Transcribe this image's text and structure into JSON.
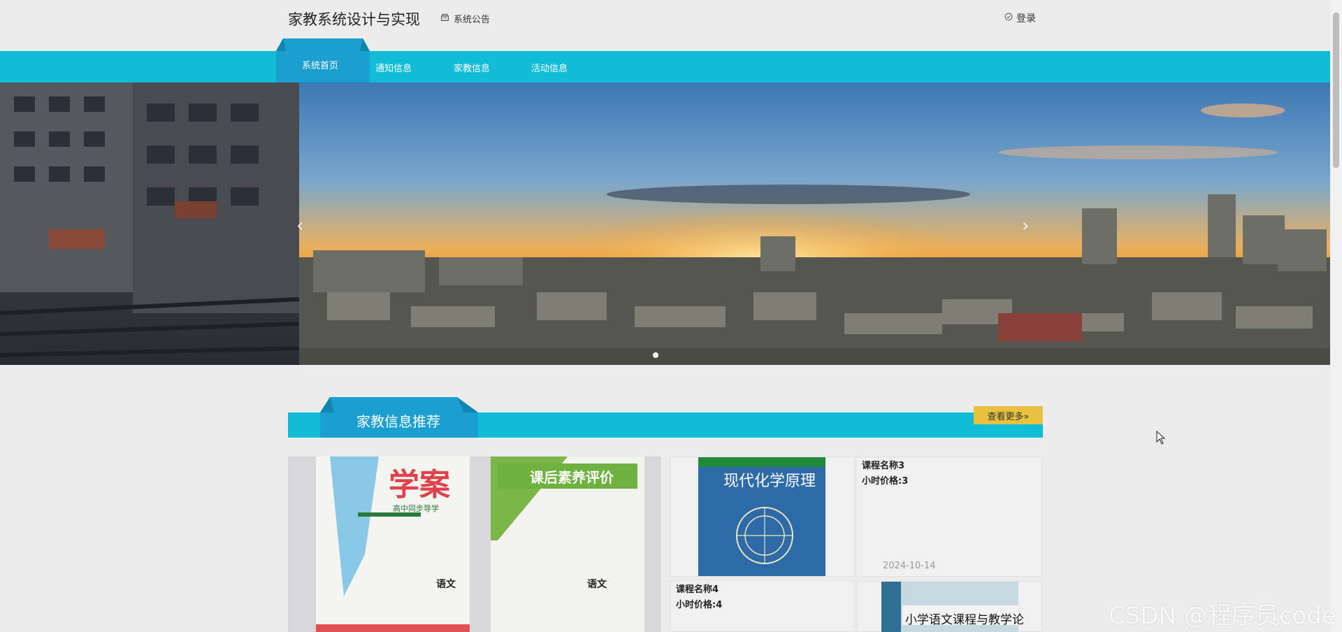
{
  "header": {
    "site_title": "家教系统设计与实现",
    "notice_label": "系统公告",
    "login_label": "登录"
  },
  "nav": {
    "items": [
      {
        "label": "系统首页",
        "active": true
      },
      {
        "label": "通知信息",
        "active": false
      },
      {
        "label": "家教信息",
        "active": false
      },
      {
        "label": "活动信息",
        "active": false
      }
    ]
  },
  "banner": {
    "prev_icon": "chevron-left-icon",
    "next_icon": "chevron-right-icon",
    "dot_count": 1
  },
  "section": {
    "title": "家教信息推荐",
    "more_label": "查看更多»"
  },
  "cards": {
    "big_book_left_title": "学案",
    "big_book_left_sub": "高中同步导学",
    "big_book_left_subject": "语文",
    "big_book_right_title": "课后素养评价",
    "big_book_right_subject": "语文",
    "card3": {
      "book_title": "现代化学原理",
      "name": "课程名称3",
      "price": "小时价格:3",
      "date": "2024-10-14"
    },
    "card4": {
      "name": "课程名称4",
      "price": "小时价格:4",
      "book_title": "小学语文课程与教学论"
    }
  },
  "watermark": "CSDN @程序员code",
  "colors": {
    "nav_bg": "#10bcd8",
    "nav_active": "#1a9fd0",
    "more_btn": "#e8c23e"
  }
}
